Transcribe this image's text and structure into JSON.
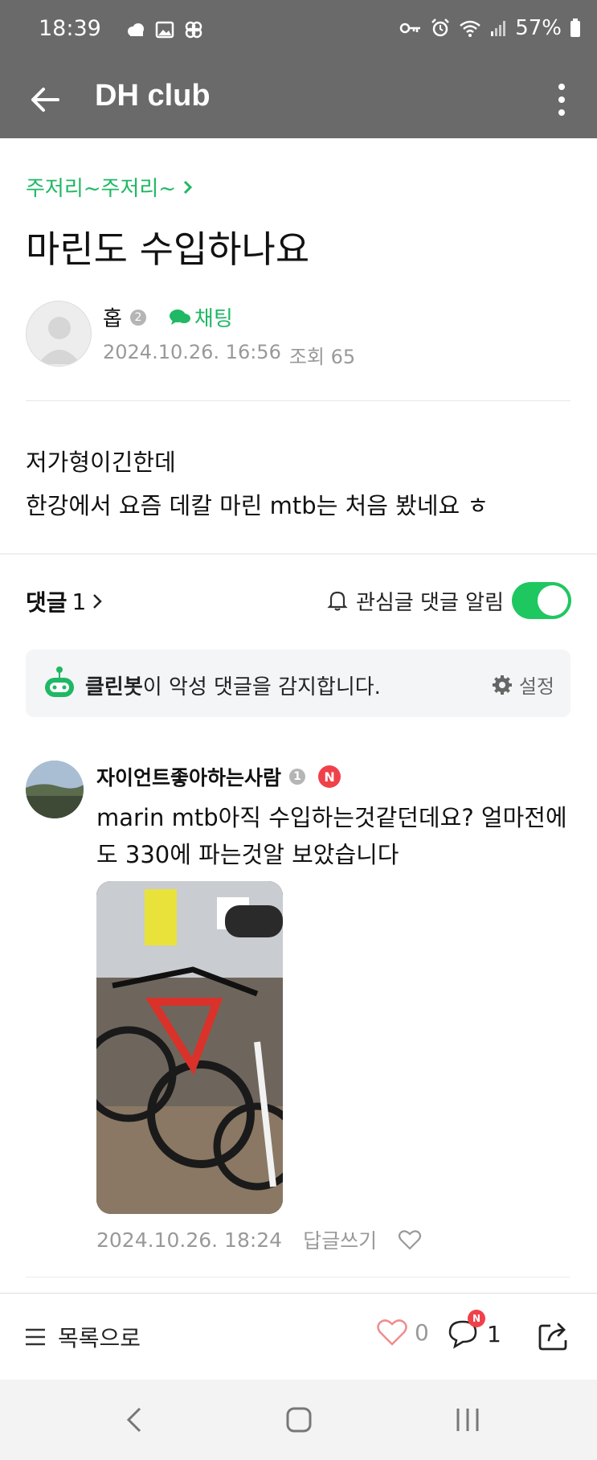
{
  "status_bar": {
    "time": "18:39",
    "battery": "57%"
  },
  "app_bar": {
    "title": "DH club"
  },
  "post": {
    "category": "주저리~주저리~",
    "title": "마린도 수입하나요",
    "author": {
      "name": "홉",
      "level": "2",
      "chat_label": "채팅"
    },
    "date": "2024.10.26. 16:56",
    "views": "조회 65",
    "body_lines": [
      "저가형이긴한데",
      "한강에서 요즘 데칼 마린 mtb는 처음 봤네요 ㅎ"
    ]
  },
  "comments_section": {
    "label": "댓글",
    "count": "1",
    "notify_label": "관심글 댓글 알림",
    "notify_on": true,
    "cleanbot": {
      "bold": "클린봇",
      "rest": "이 악성 댓글을 감지합니다.",
      "setting": "설정"
    }
  },
  "comments": [
    {
      "author": "자이언트좋아하는사람",
      "level": "1",
      "new_badge": "N",
      "text": "marin mtb아직 수입하는것같던데요? 얼마전에도 330에 파는것알 보았습니다",
      "date": "2024.10.26. 18:24",
      "reply_label": "답글쓰기"
    }
  ],
  "bottom_bar": {
    "list_label": "목록으로",
    "like_count": "0",
    "comment_count": "1",
    "comment_badge": "N"
  },
  "colors": {
    "accent": "#1fb864",
    "toggle": "#1fc760",
    "badge": "#f0414a",
    "appbar": "#6a6a6a"
  }
}
